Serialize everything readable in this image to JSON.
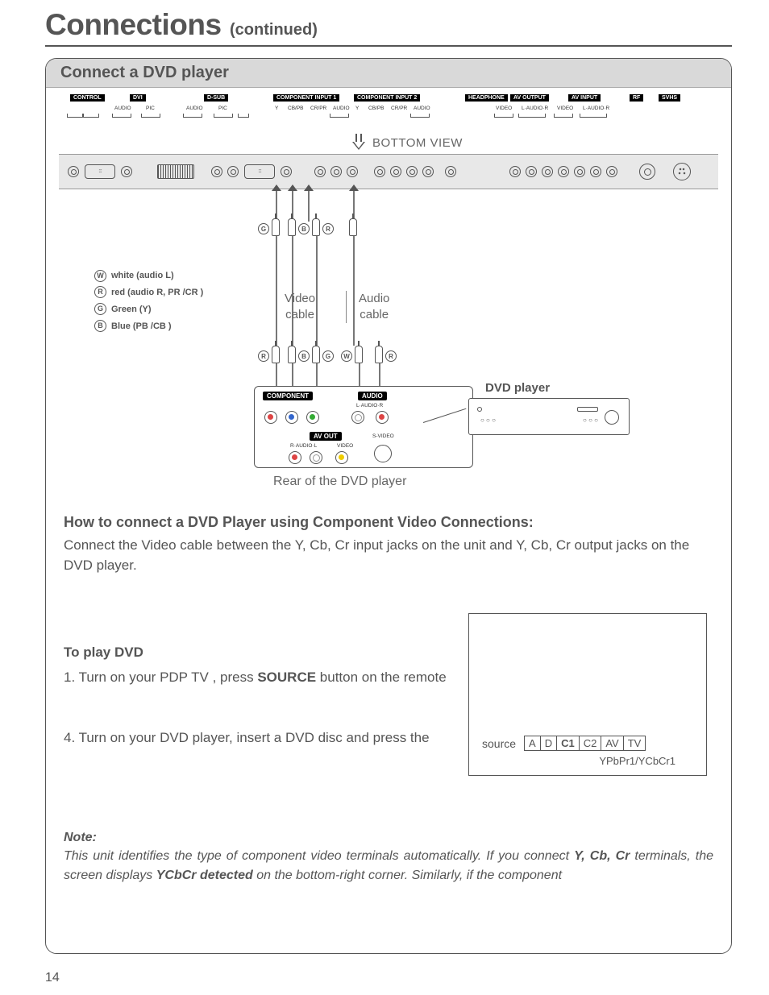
{
  "title_main": "Connections",
  "title_sub": "(continued)",
  "section_header": "Connect a DVD player",
  "top_labels": {
    "control": "CONTROL",
    "dvi": "DVI",
    "dsub": "D-SUB",
    "comp1": "COMPONENT INPUT 1",
    "comp2": "COMPONENT INPUT 2",
    "headphone": "HEADPHONE",
    "av_output": "AV OUTPUT",
    "av_input": "AV INPUT",
    "rf": "RF",
    "svhs": "SVHS",
    "audio": "AUDIO",
    "pic": "PIC",
    "y": "Y",
    "cbpb": "CB/PB",
    "crpr": "CR/PR",
    "video": "VIDEO",
    "l_audio_r": "L·AUDIO·R"
  },
  "bottom_view": "BOTTOM VIEW",
  "legend": {
    "w": "white (audio L)",
    "r": "red (audio R, PR /CR )",
    "g": "Green (Y)",
    "b": "Blue (PB /CB )"
  },
  "video_cable": "Video\ncable",
  "audio_cable": "Audio\ncable",
  "dvd_player": "DVD player",
  "dvd_labels": {
    "component": "COMPONENT",
    "audio": "AUDIO",
    "r_audio_l": "R·AUDIO·L",
    "l_audio_r": "L·AUDIO·R",
    "av_out": "AV OUT",
    "video": "VIDEO",
    "s_video": "S-VIDEO"
  },
  "rear_label": "Rear of the DVD player",
  "howto_heading": "How to connect a DVD Player using Component Video Connections:",
  "howto_body": "Connect the Video cable between the Y, Cb, Cr input jacks on the unit and Y, Cb, Cr output jacks on the DVD player.",
  "play_heading": "To play DVD",
  "step1_a": "1. Turn on your PDP TV , press ",
  "step1_b": "SOURCE",
  "step1_c": "    button on the remote",
  "step4": "4. Turn on your DVD player, insert a DVD disc and press the",
  "osd": {
    "source": "source",
    "cells": [
      "A",
      "D",
      "C1",
      "C2",
      "AV",
      "TV"
    ],
    "selected_index": 2,
    "sub": "YPbPr1/YCbCr1"
  },
  "note_heading": "Note:",
  "note_body_1": "This unit identifies the type of component video terminals automatically. If you connect ",
  "note_body_2": "Y, Cb, Cr",
  "note_body_3": " terminals, the screen displays ",
  "note_body_4": "YCbCr detected",
  "note_body_5": "  on the bottom-right corner. Similarly, if the component",
  "page_number": "14"
}
